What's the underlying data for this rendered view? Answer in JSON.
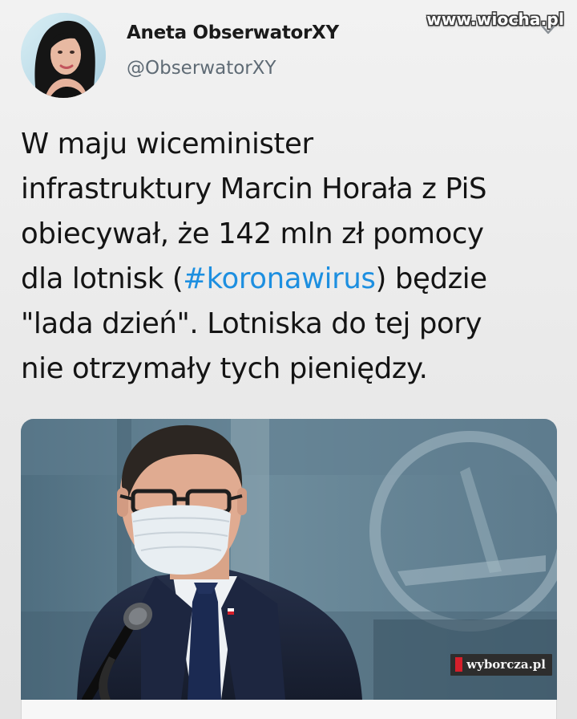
{
  "watermark": "www.wiocha.pl",
  "header": {
    "display_name": "Aneta ObserwatorXY",
    "handle": "@ObserwatorXY",
    "avatar_icon": "profile-photo"
  },
  "tweet": {
    "lines": [
      "W maju wiceminister",
      "infrastruktury Marcin Horała z PiS",
      "obiecywał, że 142 mln zł pomocy"
    ],
    "line4_before": "dla lotnisk (",
    "hashtag": "#koronawirus",
    "line4_after": ") będzie",
    "line5": "\"lada dzień\". Lotniska do tej pory",
    "line6": "nie otrzymały tych pieniędzy.",
    "hashtag_color": "#1d8fe0"
  },
  "media": {
    "source_label": "wyborcza.pl",
    "source_mark_color": "#d51f2b"
  }
}
